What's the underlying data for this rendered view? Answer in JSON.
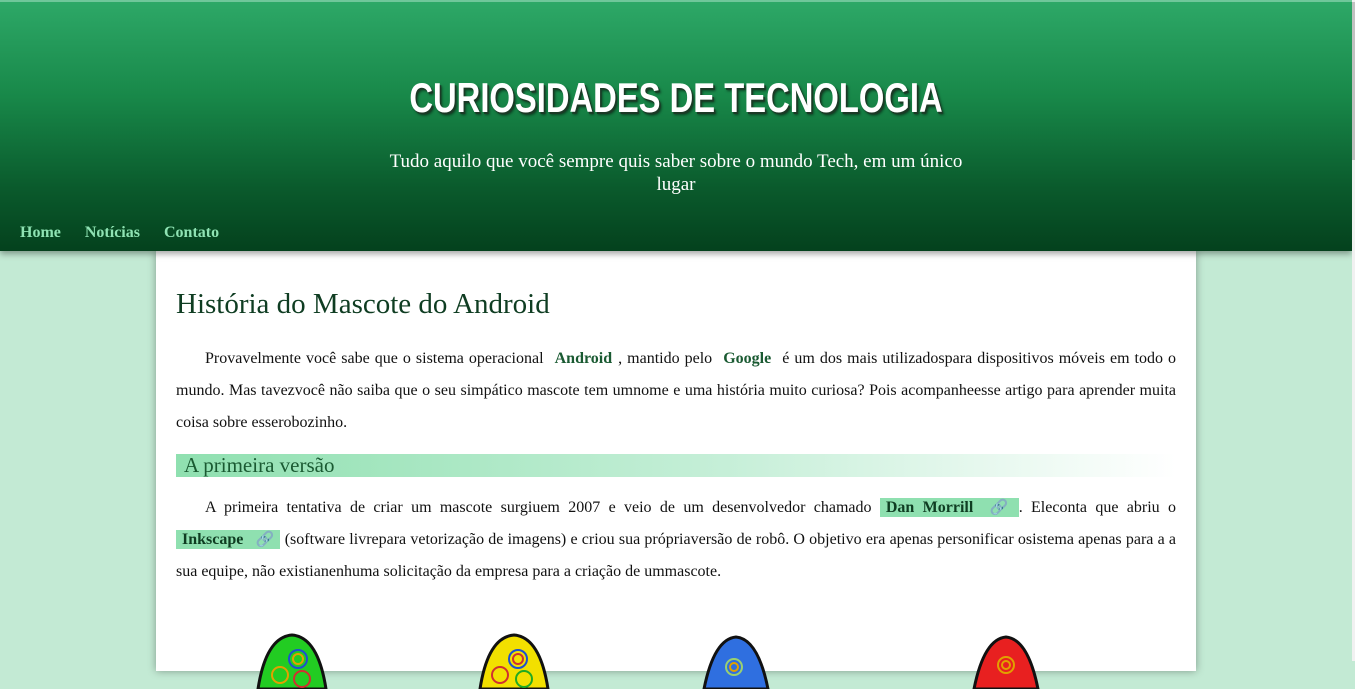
{
  "site": {
    "title": "CURIOSIDADES DE TECNOLOGIA",
    "subtitle": "Tudo aquilo que você sempre quis saber sobre o mundo Tech, em um único lugar"
  },
  "nav": {
    "items": [
      "Home",
      "Notícias",
      "Contato"
    ]
  },
  "article": {
    "title": "História do Mascote do Android",
    "intro": {
      "t1": "Provavelmente você sabe que o sistema operacional",
      "kw1": "Android",
      "t2": ", mantido pelo",
      "kw2": "Google",
      "t3": "é um dos mais utilizadospara dispositivos móveis em todo o mundo. Mas tavezvocê não saiba que o seu simpático mascote tem umnome e uma história muito curiosa? Pois acompanheesse artigo para aprender muita coisa sobre esserobozinho."
    },
    "section1": {
      "heading": "A primeira versão",
      "t1": "A primeira tentativa de criar um mascote surgiuem 2007 e veio de um desenvolvedor chamado",
      "link1": "Dan Morrill",
      "t2": ". Eleconta que abriu o",
      "link2": "Inkscape",
      "t3": "(software livrepara vetorização de imagens) e criou sua própriaversão de robô. O objetivo era apenas personificar osistema apenas para a a sua equipe, não existianenhuma solicitação da empresa para a criação de ummascote."
    },
    "mascot_colors": [
      "#22cc22",
      "#f2e000",
      "#2f6fe0",
      "#e82020"
    ]
  },
  "colors": {
    "header_top": "#2da867",
    "header_bottom": "#04411d",
    "nav_link": "#8fe3b3",
    "page_background": "#c3ead4",
    "highlight": "#8fe0b0"
  }
}
